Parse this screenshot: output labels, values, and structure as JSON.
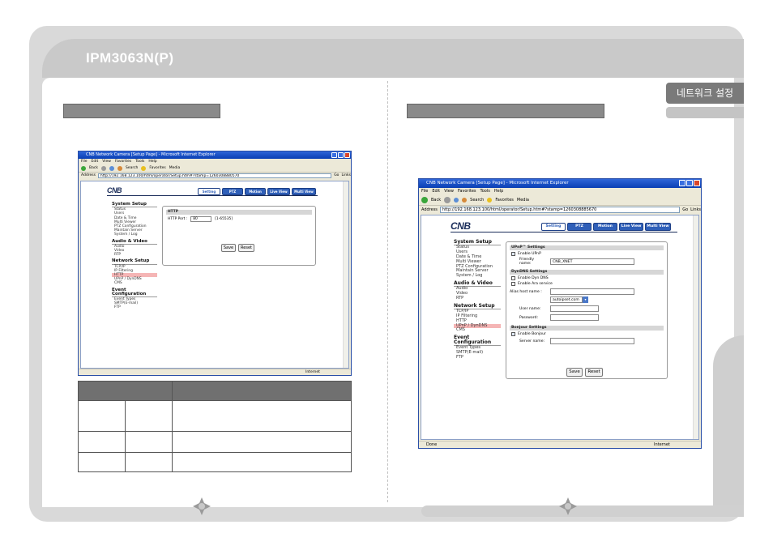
{
  "document": {
    "title": "IPM3063N(P)",
    "section_tab": "네트워크 설정"
  },
  "browser": {
    "window_title": "CNB Network Camera [Setup Page] - Microsoft Internet Explorer",
    "menu": [
      "File",
      "Edit",
      "View",
      "Favorites",
      "Tools",
      "Help"
    ],
    "toolbar": {
      "back": "Back",
      "search": "Search",
      "favorites": "Favorites",
      "media": "Media"
    },
    "address_label": "Address",
    "go_label": "Go",
    "links_label": "Links",
    "status_internet": "Internet",
    "status_done": "Done"
  },
  "left_screen": {
    "url": "http://192.168.123.100/html/operator/Setup.htm#?stamp=1260308880570",
    "logo": "CNB",
    "tabs": [
      "Setting",
      "PTZ",
      "Motion",
      "Live View",
      "Multi View"
    ],
    "menu_groups": [
      {
        "title": "System Setup",
        "items": [
          "Status",
          "Users",
          "Date & Time",
          "Multi Viewer",
          "PTZ Configuration",
          "Maintain Server",
          "System / Log"
        ]
      },
      {
        "title": "Audio & Video",
        "items": [
          "Audio",
          "Video",
          "RTP"
        ]
      },
      {
        "title": "Network Setup",
        "items": [
          "TCP/IP",
          "IP Filtering",
          "HTTP",
          "UPnP / DynDNS",
          "CMS"
        ]
      },
      {
        "title": "Event Configuration",
        "items": [
          "Event Types",
          "SMTP(E-mail)",
          "FTP"
        ]
      }
    ],
    "active_item": "HTTP",
    "panel": {
      "heading": "HTTP",
      "field_label": "HTTP Port :",
      "field_value": "80",
      "field_hint": "[1-65535]",
      "save": "Save",
      "reset": "Reset"
    }
  },
  "right_screen": {
    "url": "http://192.168.123.100/html/operator/Setup.htm#?stamp=1260308885670",
    "logo": "CNB",
    "tabs": [
      "Setting",
      "PTZ",
      "Motion",
      "Live View",
      "Multi View"
    ],
    "menu_groups": [
      {
        "title": "System Setup",
        "items": [
          "Status",
          "Users",
          "Date & Time",
          "Multi Viewer",
          "PTZ Configuration",
          "Maintain Server",
          "System / Log"
        ]
      },
      {
        "title": "Audio & Video",
        "items": [
          "Audio",
          "Video",
          "RTP"
        ]
      },
      {
        "title": "Network Setup",
        "items": [
          "TCP/IP",
          "IP Filtering",
          "HTTP",
          "UPnP / DynDNS",
          "CMS"
        ]
      },
      {
        "title": "Event Configuration",
        "items": [
          "Event Types",
          "SMTP(E-mail)",
          "FTP"
        ]
      }
    ],
    "active_item": "UPnP / DynDNS",
    "upnp": {
      "heading": "UPnP™ Settings",
      "enable_label": "Enable UPnP",
      "friendly_label": "Friendly name:",
      "friendly_value": "CNB_XNET"
    },
    "dyndns": {
      "heading": "DynDNS Settings",
      "enable_dyn": "Enable Dyn DNS",
      "enable_ara": "Enable Ara service",
      "alias_label": "Alias host name :",
      "alias_value": "",
      "domain_value": "autoipset.com",
      "user_label": "User name:",
      "password_label": "Password:"
    },
    "bonjour": {
      "heading": "Bonjour Settings",
      "enable_label": "Enable Bonjour",
      "server_label": "Server name:"
    },
    "save": "Save",
    "reset": "Reset"
  },
  "colors": {
    "frame": "#d9d9d9",
    "heading_bar": "#8a8a8a",
    "nav_tab": "#2f5fb8",
    "active_item": "#f5b5b5"
  }
}
